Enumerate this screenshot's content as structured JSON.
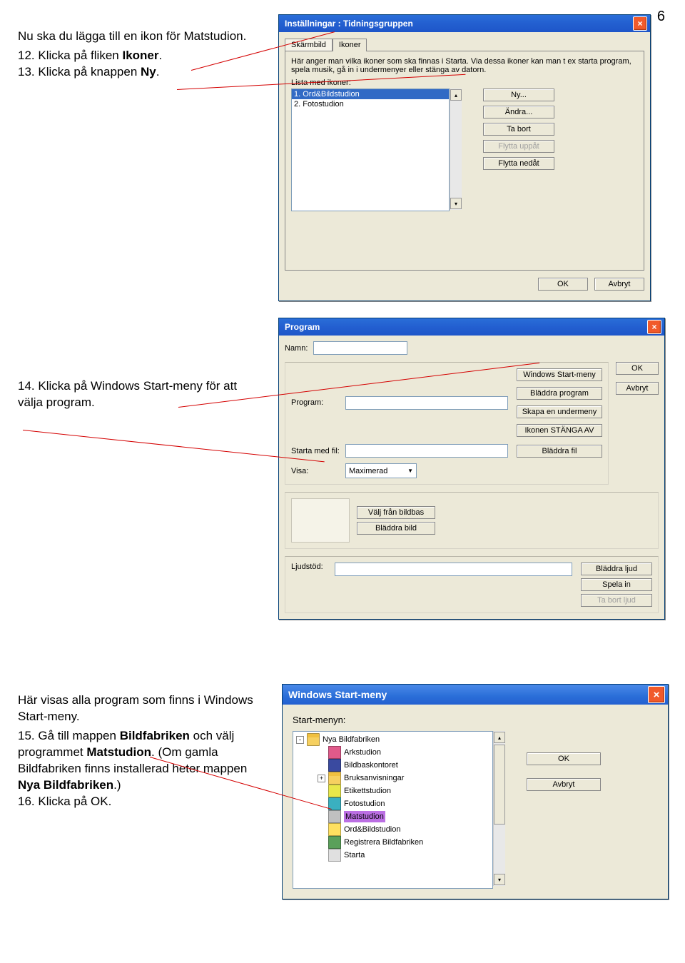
{
  "page_number": "6",
  "instr": {
    "p1": "Nu ska du lägga till en ikon för Matstudion.",
    "l12a": "12. Klicka på fliken ",
    "l12b": "Ikoner",
    "l12c": ".",
    "l13a": "13. Klicka på knappen ",
    "l13b": "Ny",
    "l13c": ".",
    "l14a": "14. Klicka på Windows Start-meny för att välja program.",
    "p2": "Här visas alla program som finns i Windows Start-meny.",
    "l15a": "15. Gå till mappen ",
    "l15b": "Bildfabriken",
    "l15c": " och välj programmet ",
    "l15d": "Matstudion",
    "l15e": ". (Om gamla Bildfabriken finns installerad heter mappen ",
    "l15f": "Nya Bildfabriken",
    "l15g": ".)",
    "l16": "16. Klicka på OK."
  },
  "dlg1": {
    "title": "Inställningar : Tidningsgruppen",
    "tab1": "Skärmbild",
    "tab2": "Ikoner",
    "desc": "Här anger man vilka ikoner som ska finnas i Starta. Via dessa ikoner kan man t ex starta program, spela musik, gå in i undermenyer eller stänga av datorn.",
    "list_label": "Lista med ikoner:",
    "items": [
      "1. Ord&Bildstudion",
      "2. Fotostudion"
    ],
    "btns": [
      "Ny...",
      "Ändra...",
      "Ta bort",
      "Flytta uppåt",
      "Flytta nedåt"
    ],
    "ok": "OK",
    "cancel": "Avbryt"
  },
  "dlg2": {
    "title": "Program",
    "namn": "Namn:",
    "program": "Program:",
    "starta": "Starta med fil:",
    "visa": "Visa:",
    "visa_val": "Maximerad",
    "ljud": "Ljudstöd:",
    "b_win": "Windows Start-meny",
    "b_blp": "Bläddra program",
    "b_under": "Skapa en undermeny",
    "b_stang": "Ikonen STÄNGA AV",
    "b_blfil": "Bläddra fil",
    "b_bildbas": "Välj från bildbas",
    "b_blbild": "Bläddra bild",
    "b_blljud": "Bläddra ljud",
    "b_spela": "Spela in",
    "b_tabort": "Ta bort ljud",
    "ok": "OK",
    "cancel": "Avbryt"
  },
  "dlg3": {
    "title": "Windows Start-meny",
    "label": "Start-menyn:",
    "items": [
      {
        "pm": "-",
        "icon": "folder",
        "text": "Nya Bildfabriken"
      },
      {
        "indent": 1,
        "icon": "app1",
        "text": "Arkstudion"
      },
      {
        "indent": 1,
        "icon": "app2",
        "text": "Bildbaskontoret"
      },
      {
        "indent": 1,
        "pm": "+",
        "icon": "folder",
        "text": "Bruksanvisningar"
      },
      {
        "indent": 1,
        "icon": "app3",
        "text": "Etikettstudion"
      },
      {
        "indent": 1,
        "icon": "app4",
        "text": "Fotostudion"
      },
      {
        "indent": 1,
        "icon": "app5",
        "text": "Matstudion",
        "sel": true
      },
      {
        "indent": 1,
        "icon": "app6",
        "text": "Ord&Bildstudion"
      },
      {
        "indent": 1,
        "icon": "app7",
        "text": "Registrera Bildfabriken"
      },
      {
        "indent": 1,
        "icon": "app8",
        "text": "Starta"
      }
    ],
    "ok": "OK",
    "cancel": "Avbryt"
  }
}
